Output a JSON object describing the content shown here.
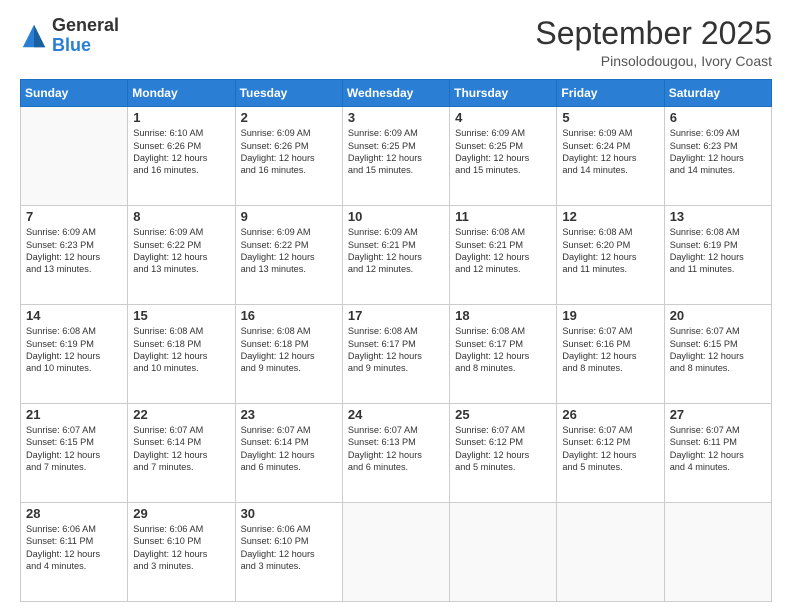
{
  "header": {
    "logo_general": "General",
    "logo_blue": "Blue",
    "month_title": "September 2025",
    "subtitle": "Pinsolodougou, Ivory Coast"
  },
  "weekdays": [
    "Sunday",
    "Monday",
    "Tuesday",
    "Wednesday",
    "Thursday",
    "Friday",
    "Saturday"
  ],
  "weeks": [
    [
      {
        "day": "",
        "info": ""
      },
      {
        "day": "1",
        "info": "Sunrise: 6:10 AM\nSunset: 6:26 PM\nDaylight: 12 hours\nand 16 minutes."
      },
      {
        "day": "2",
        "info": "Sunrise: 6:09 AM\nSunset: 6:26 PM\nDaylight: 12 hours\nand 16 minutes."
      },
      {
        "day": "3",
        "info": "Sunrise: 6:09 AM\nSunset: 6:25 PM\nDaylight: 12 hours\nand 15 minutes."
      },
      {
        "day": "4",
        "info": "Sunrise: 6:09 AM\nSunset: 6:25 PM\nDaylight: 12 hours\nand 15 minutes."
      },
      {
        "day": "5",
        "info": "Sunrise: 6:09 AM\nSunset: 6:24 PM\nDaylight: 12 hours\nand 14 minutes."
      },
      {
        "day": "6",
        "info": "Sunrise: 6:09 AM\nSunset: 6:23 PM\nDaylight: 12 hours\nand 14 minutes."
      }
    ],
    [
      {
        "day": "7",
        "info": "Sunrise: 6:09 AM\nSunset: 6:23 PM\nDaylight: 12 hours\nand 13 minutes."
      },
      {
        "day": "8",
        "info": "Sunrise: 6:09 AM\nSunset: 6:22 PM\nDaylight: 12 hours\nand 13 minutes."
      },
      {
        "day": "9",
        "info": "Sunrise: 6:09 AM\nSunset: 6:22 PM\nDaylight: 12 hours\nand 13 minutes."
      },
      {
        "day": "10",
        "info": "Sunrise: 6:09 AM\nSunset: 6:21 PM\nDaylight: 12 hours\nand 12 minutes."
      },
      {
        "day": "11",
        "info": "Sunrise: 6:08 AM\nSunset: 6:21 PM\nDaylight: 12 hours\nand 12 minutes."
      },
      {
        "day": "12",
        "info": "Sunrise: 6:08 AM\nSunset: 6:20 PM\nDaylight: 12 hours\nand 11 minutes."
      },
      {
        "day": "13",
        "info": "Sunrise: 6:08 AM\nSunset: 6:19 PM\nDaylight: 12 hours\nand 11 minutes."
      }
    ],
    [
      {
        "day": "14",
        "info": "Sunrise: 6:08 AM\nSunset: 6:19 PM\nDaylight: 12 hours\nand 10 minutes."
      },
      {
        "day": "15",
        "info": "Sunrise: 6:08 AM\nSunset: 6:18 PM\nDaylight: 12 hours\nand 10 minutes."
      },
      {
        "day": "16",
        "info": "Sunrise: 6:08 AM\nSunset: 6:18 PM\nDaylight: 12 hours\nand 9 minutes."
      },
      {
        "day": "17",
        "info": "Sunrise: 6:08 AM\nSunset: 6:17 PM\nDaylight: 12 hours\nand 9 minutes."
      },
      {
        "day": "18",
        "info": "Sunrise: 6:08 AM\nSunset: 6:17 PM\nDaylight: 12 hours\nand 8 minutes."
      },
      {
        "day": "19",
        "info": "Sunrise: 6:07 AM\nSunset: 6:16 PM\nDaylight: 12 hours\nand 8 minutes."
      },
      {
        "day": "20",
        "info": "Sunrise: 6:07 AM\nSunset: 6:15 PM\nDaylight: 12 hours\nand 8 minutes."
      }
    ],
    [
      {
        "day": "21",
        "info": "Sunrise: 6:07 AM\nSunset: 6:15 PM\nDaylight: 12 hours\nand 7 minutes."
      },
      {
        "day": "22",
        "info": "Sunrise: 6:07 AM\nSunset: 6:14 PM\nDaylight: 12 hours\nand 7 minutes."
      },
      {
        "day": "23",
        "info": "Sunrise: 6:07 AM\nSunset: 6:14 PM\nDaylight: 12 hours\nand 6 minutes."
      },
      {
        "day": "24",
        "info": "Sunrise: 6:07 AM\nSunset: 6:13 PM\nDaylight: 12 hours\nand 6 minutes."
      },
      {
        "day": "25",
        "info": "Sunrise: 6:07 AM\nSunset: 6:12 PM\nDaylight: 12 hours\nand 5 minutes."
      },
      {
        "day": "26",
        "info": "Sunrise: 6:07 AM\nSunset: 6:12 PM\nDaylight: 12 hours\nand 5 minutes."
      },
      {
        "day": "27",
        "info": "Sunrise: 6:07 AM\nSunset: 6:11 PM\nDaylight: 12 hours\nand 4 minutes."
      }
    ],
    [
      {
        "day": "28",
        "info": "Sunrise: 6:06 AM\nSunset: 6:11 PM\nDaylight: 12 hours\nand 4 minutes."
      },
      {
        "day": "29",
        "info": "Sunrise: 6:06 AM\nSunset: 6:10 PM\nDaylight: 12 hours\nand 3 minutes."
      },
      {
        "day": "30",
        "info": "Sunrise: 6:06 AM\nSunset: 6:10 PM\nDaylight: 12 hours\nand 3 minutes."
      },
      {
        "day": "",
        "info": ""
      },
      {
        "day": "",
        "info": ""
      },
      {
        "day": "",
        "info": ""
      },
      {
        "day": "",
        "info": ""
      }
    ]
  ]
}
